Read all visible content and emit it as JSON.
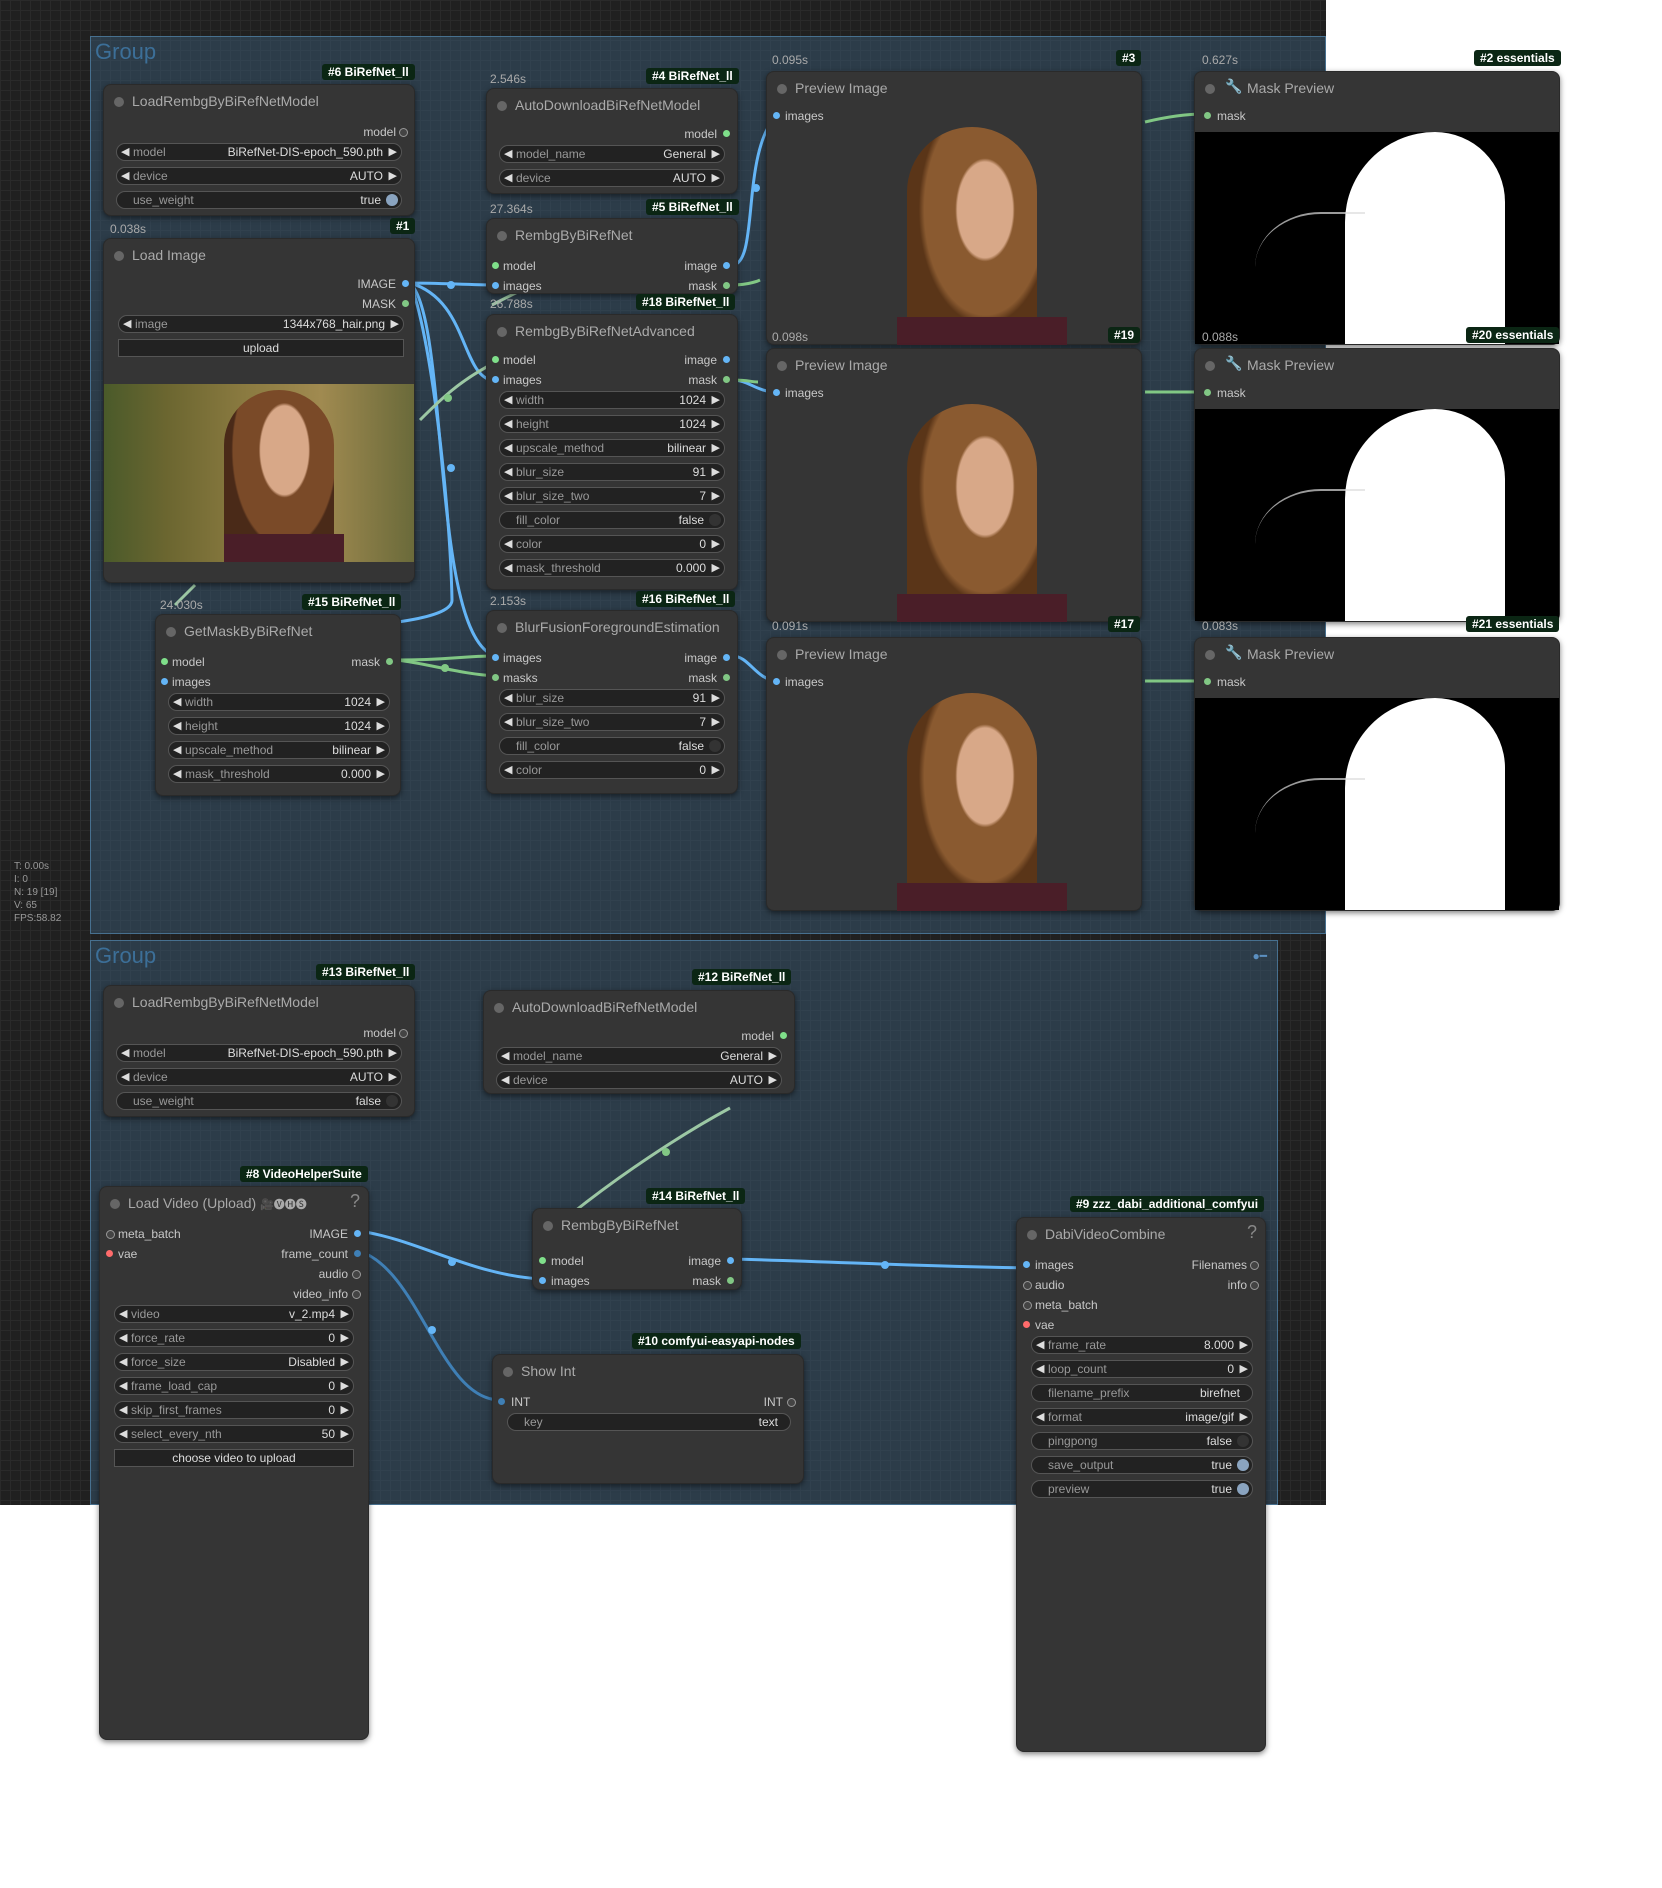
{
  "groups": [
    {
      "title": "Group"
    },
    {
      "title": "Group"
    }
  ],
  "stats": [
    "T: 0.00s",
    "I: 0",
    "N: 19 [19]",
    "V: 65",
    "FPS:58.82"
  ],
  "nodes": {
    "n6": {
      "badge": "#6 BiRefNet_ll",
      "title": "LoadRembgByBiRefNetModel",
      "out": "model",
      "model": {
        "label": "model",
        "value": "BiRefNet-DIS-epoch_590.pth"
      },
      "device": {
        "label": "device",
        "value": "AUTO"
      },
      "use_weight": {
        "label": "use_weight",
        "value": "true"
      }
    },
    "n1": {
      "timing": "0.038s",
      "badge": "#1",
      "title": "Load Image",
      "out1": "IMAGE",
      "out2": "MASK",
      "image": {
        "label": "image",
        "value": "1344x768_hair.png"
      },
      "upload": "upload"
    },
    "n4": {
      "timing": "2.546s",
      "badge": "#4 BiRefNet_ll",
      "title": "AutoDownloadBiRefNetModel",
      "out": "model",
      "model_name": {
        "label": "model_name",
        "value": "General"
      },
      "device": {
        "label": "device",
        "value": "AUTO"
      }
    },
    "n5": {
      "timing": "27.364s",
      "badge": "#5 BiRefNet_ll",
      "title": "RembgByBiRefNet",
      "in1": "model",
      "in2": "images",
      "out1": "image",
      "out2": "mask"
    },
    "n18": {
      "timing": "26.788s",
      "badge": "#18 BiRefNet_ll",
      "title": "RembgByBiRefNetAdvanced",
      "in1": "model",
      "in2": "images",
      "out1": "image",
      "out2": "mask",
      "width": {
        "label": "width",
        "value": "1024"
      },
      "height": {
        "label": "height",
        "value": "1024"
      },
      "upscale_method": {
        "label": "upscale_method",
        "value": "bilinear"
      },
      "blur_size": {
        "label": "blur_size",
        "value": "91"
      },
      "blur_size_two": {
        "label": "blur_size_two",
        "value": "7"
      },
      "fill_color": {
        "label": "fill_color",
        "value": "false"
      },
      "color": {
        "label": "color",
        "value": "0"
      },
      "mask_threshold": {
        "label": "mask_threshold",
        "value": "0.000"
      }
    },
    "n15": {
      "timing": "24.030s",
      "badge": "#15 BiRefNet_ll",
      "title": "GetMaskByBiRefNet",
      "in1": "model",
      "in2": "images",
      "out": "mask",
      "width": {
        "label": "width",
        "value": "1024"
      },
      "height": {
        "label": "height",
        "value": "1024"
      },
      "upscale_method": {
        "label": "upscale_method",
        "value": "bilinear"
      },
      "mask_threshold": {
        "label": "mask_threshold",
        "value": "0.000"
      }
    },
    "n16": {
      "timing": "2.153s",
      "badge": "#16 BiRefNet_ll",
      "title": "BlurFusionForegroundEstimation",
      "in1": "images",
      "in2": "masks",
      "out1": "image",
      "out2": "mask",
      "blur_size": {
        "label": "blur_size",
        "value": "91"
      },
      "blur_size_two": {
        "label": "blur_size_two",
        "value": "7"
      },
      "fill_color": {
        "label": "fill_color",
        "value": "false"
      },
      "color": {
        "label": "color",
        "value": "0"
      }
    },
    "n3": {
      "timing": "0.095s",
      "badge": "#3",
      "title": "Preview Image",
      "in": "images"
    },
    "n19": {
      "timing": "0.098s",
      "badge": "#19",
      "title": "Preview Image",
      "in": "images"
    },
    "n17": {
      "timing": "0.091s",
      "badge": "#17",
      "title": "Preview Image",
      "in": "images"
    },
    "n2": {
      "timing": "0.627s",
      "badge": "#2 essentials",
      "title": "Mask Preview",
      "in": "mask"
    },
    "n20": {
      "timing": "0.088s",
      "badge": "#20 essentials",
      "title": "Mask Preview",
      "in": "mask"
    },
    "n21": {
      "timing": "0.083s",
      "badge": "#21 essentials",
      "title": "Mask Preview",
      "in": "mask"
    },
    "n13": {
      "badge": "#13 BiRefNet_ll",
      "title": "LoadRembgByBiRefNetModel",
      "out": "model",
      "model": {
        "label": "model",
        "value": "BiRefNet-DIS-epoch_590.pth"
      },
      "device": {
        "label": "device",
        "value": "AUTO"
      },
      "use_weight": {
        "label": "use_weight",
        "value": "false"
      }
    },
    "n12": {
      "badge": "#12 BiRefNet_ll",
      "title": "AutoDownloadBiRefNetModel",
      "out": "model",
      "model_name": {
        "label": "model_name",
        "value": "General"
      },
      "device": {
        "label": "device",
        "value": "AUTO"
      }
    },
    "n8": {
      "badge": "#8 VideoHelperSuite",
      "title": "Load Video (Upload)",
      "emoji": "🎥🅥🅗🅢",
      "help": "?",
      "in1": "meta_batch",
      "in2": "vae",
      "out1": "IMAGE",
      "out2": "frame_count",
      "out3": "audio",
      "out4": "video_info",
      "video": {
        "label": "video",
        "value": "v_2.mp4"
      },
      "force_rate": {
        "label": "force_rate",
        "value": "0"
      },
      "force_size": {
        "label": "force_size",
        "value": "Disabled"
      },
      "frame_load_cap": {
        "label": "frame_load_cap",
        "value": "0"
      },
      "skip_first_frames": {
        "label": "skip_first_frames",
        "value": "0"
      },
      "select_every_nth": {
        "label": "select_every_nth",
        "value": "50"
      },
      "upload": "choose video to upload"
    },
    "n14": {
      "badge": "#14 BiRefNet_ll",
      "title": "RembgByBiRefNet",
      "in1": "model",
      "in2": "images",
      "out1": "image",
      "out2": "mask"
    },
    "n10": {
      "badge": "#10 comfyui-easyapi-nodes",
      "title": "Show Int",
      "in": "INT",
      "out": "INT",
      "key": {
        "label": "key",
        "value": "text"
      }
    },
    "n9": {
      "badge": "#9 zzz_dabi_additional_comfyui",
      "title": "DabiVideoCombine",
      "help": "?",
      "in1": "images",
      "in2": "audio",
      "in3": "meta_batch",
      "in4": "vae",
      "out1": "Filenames",
      "out2": "info",
      "frame_rate": {
        "label": "frame_rate",
        "value": "8.000"
      },
      "loop_count": {
        "label": "loop_count",
        "value": "0"
      },
      "filename_prefix": {
        "label": "filename_prefix",
        "value": "birefnet"
      },
      "format": {
        "label": "format",
        "value": "image/gif"
      },
      "pingpong": {
        "label": "pingpong",
        "value": "false"
      },
      "save_output": {
        "label": "save_output",
        "value": "true"
      },
      "preview": {
        "label": "preview",
        "value": "true"
      }
    }
  },
  "colors": {
    "model_wire": "#7fdf8a",
    "image_wire": "#64b5f6",
    "mask_wire": "#81c784",
    "vae": "#ff6b6b",
    "badge": "#0b2614"
  }
}
